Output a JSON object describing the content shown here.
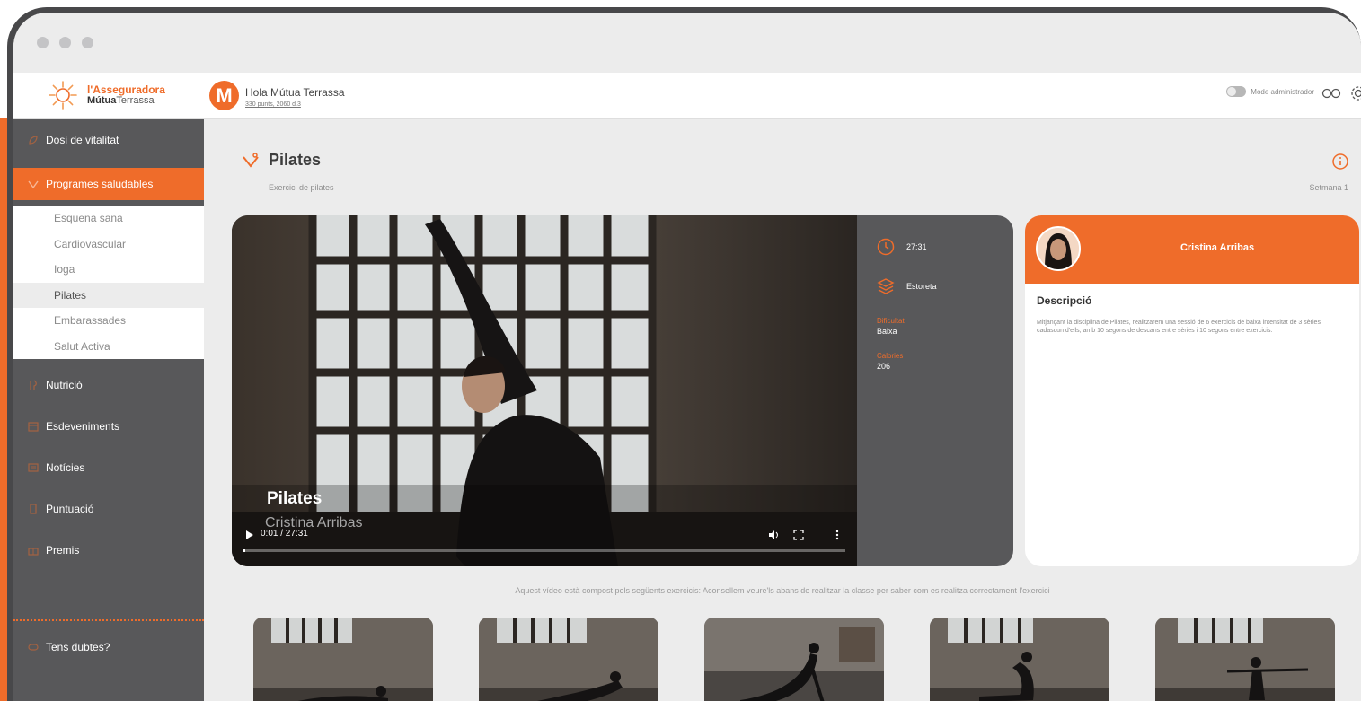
{
  "window": {
    "controls": [
      "close",
      "minimize",
      "maximize"
    ]
  },
  "topbar": {
    "logo": {
      "line1": "l'Asseguradora",
      "line2_bold": "Mútua",
      "line2": "Terrassa",
      "icon": "sun-logo-icon"
    },
    "greeting": {
      "avatar_letter": "M",
      "title": "Hola Mútua Terrassa",
      "points": "330 punts, 2060 d.3"
    },
    "admin_mode_label": "Mode administrador",
    "admin_mode_on": false,
    "icons": [
      "glasses-icon",
      "gear-icon"
    ]
  },
  "sidebar": {
    "items": [
      {
        "label": "Dosi de vitalitat",
        "icon": "leaf-icon"
      },
      {
        "label": "Programes saludables",
        "icon": "fitness-icon",
        "active": true
      },
      {
        "label": "Nutrició",
        "icon": "food-icon"
      },
      {
        "label": "Esdeveniments",
        "icon": "calendar-icon"
      },
      {
        "label": "Notícies",
        "icon": "news-icon"
      },
      {
        "label": "Puntuació",
        "icon": "score-icon"
      },
      {
        "label": "Premis",
        "icon": "gift-icon"
      }
    ],
    "subitems": [
      {
        "label": "Esquena sana"
      },
      {
        "label": "Cardiovascular"
      },
      {
        "label": "Ioga"
      },
      {
        "label": "Pilates",
        "selected": true
      },
      {
        "label": "Embarassades"
      },
      {
        "label": "Salut Activa"
      }
    ],
    "help": {
      "label": "Tens dubtes?",
      "icon": "question-icon"
    }
  },
  "page": {
    "title": "Pilates",
    "subtitle": "Exercici de pilates",
    "week": "Setmana 1",
    "title_icon": "exercise-icon"
  },
  "video": {
    "title": "Pilates",
    "subtitle": "Cristina Arribas",
    "time": "0:01 / 27:31",
    "progress": 0.003
  },
  "stats": {
    "duration": "27:31",
    "material": "Estoreta",
    "difficulty_label": "Dificultat",
    "difficulty": "Baixa",
    "calories_label": "Calories",
    "calories": "206"
  },
  "instructor": {
    "name": "Cristina Arribas",
    "description_title": "Descripció",
    "description": "Mitjançant la disciplina de Pilates, realitzarem una sessió de 6 exercicis de baixa intensitat de 3 sèries cadascun d'ells, amb 10 segons de descans entre sèries i 10 segons entre exercicis."
  },
  "exercises": {
    "note": "Aquest vídeo està compost pels següents exercicis: Aconsellem veure'ls abans de realitzar la classe per saber com es realitza correctament l'exercici",
    "count_visible": 5
  },
  "colors": {
    "accent": "#ef6c2a",
    "sidebar": "#58585a",
    "frame": "#48484a",
    "background": "#ececec"
  }
}
